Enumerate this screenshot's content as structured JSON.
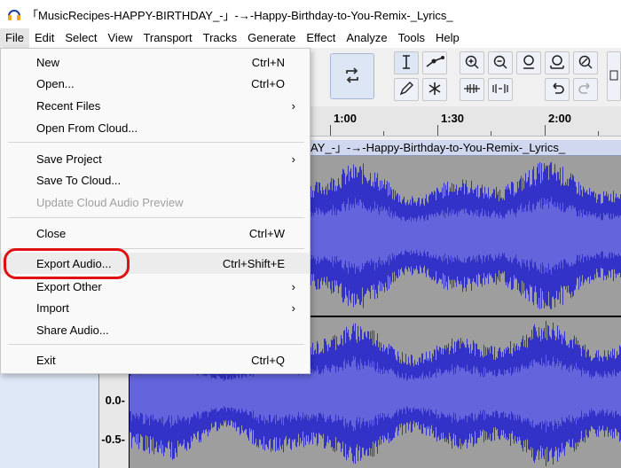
{
  "window": {
    "title": "「MusicRecipes-HAPPY-BIRTHDAY_-」-→-Happy-Birthday-to-You-Remix-_Lyrics_"
  },
  "menubar": {
    "items": [
      "File",
      "Edit",
      "Select",
      "View",
      "Transport",
      "Tracks",
      "Generate",
      "Effect",
      "Analyze",
      "Tools",
      "Help"
    ]
  },
  "file_menu": {
    "items": [
      {
        "label": "New",
        "shortcut": "Ctrl+N"
      },
      {
        "label": "Open...",
        "shortcut": "Ctrl+O"
      },
      {
        "label": "Recent Files",
        "submenu": "›"
      },
      {
        "label": "Open From Cloud..."
      },
      {
        "label": "Save Project",
        "submenu": "›"
      },
      {
        "label": "Save To Cloud..."
      },
      {
        "label": "Update Cloud Audio Preview",
        "disabled": true
      },
      {
        "label": "Close",
        "shortcut": "Ctrl+W"
      },
      {
        "label": "Export Audio...",
        "shortcut": "Ctrl+Shift+E"
      },
      {
        "label": "Export Other",
        "submenu": "›"
      },
      {
        "label": "Import",
        "submenu": "›"
      },
      {
        "label": "Share Audio..."
      },
      {
        "label": "Exit",
        "shortcut": "Ctrl+Q"
      }
    ]
  },
  "ruler": {
    "labels": [
      "1:00",
      "1:30",
      "2:00"
    ]
  },
  "track": {
    "name": "AY_-」-→-Happy-Birthday-to-You-Remix-_Lyrics_"
  },
  "scale": {
    "labels": [
      "0.0-",
      "-0.5-"
    ]
  },
  "colors": {
    "waveform": "#3232c8",
    "waveform_rms": "#6464dc",
    "background": "#9e9e9e",
    "highlight": "#e01010"
  }
}
